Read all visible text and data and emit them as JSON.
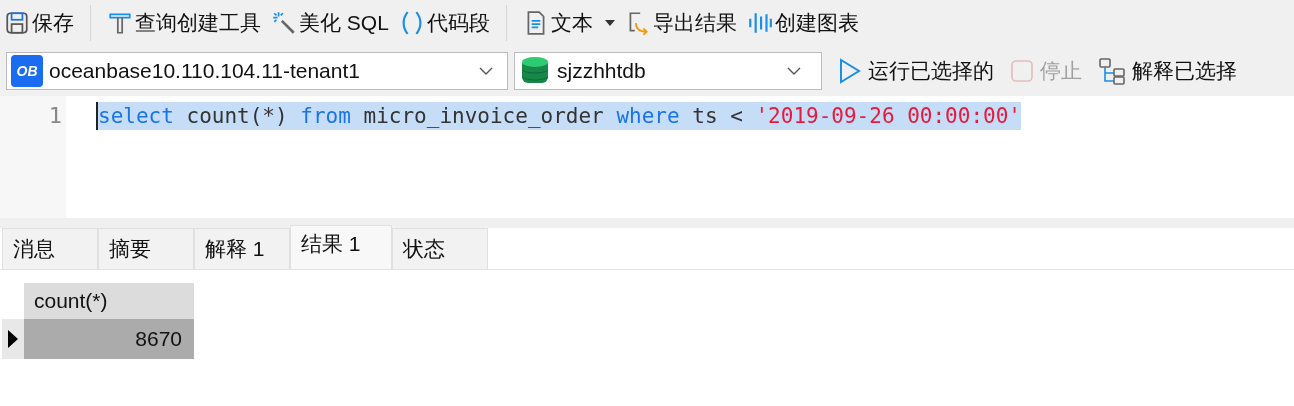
{
  "toolbar": [
    {
      "kind": "save",
      "label": "保存"
    },
    {
      "kind": "builder",
      "label": "查询创建工具"
    },
    {
      "kind": "beautify",
      "label": "美化 SQL"
    },
    {
      "kind": "snippet",
      "label": "代码段"
    },
    {
      "kind": "text",
      "label": "文本",
      "dropdown": true
    },
    {
      "kind": "export",
      "label": "导出结果"
    },
    {
      "kind": "chart",
      "label": "创建图表"
    }
  ],
  "connection": {
    "value": "oceanbase10.110.104.11-tenant1",
    "badge": "OB"
  },
  "database": {
    "value": "sjzzhhtdb"
  },
  "actions": [
    {
      "kind": "run",
      "label": "运行已选择的",
      "disabled": false
    },
    {
      "kind": "stop",
      "label": "停止",
      "disabled": true
    },
    {
      "kind": "explain",
      "label": "解释已选择",
      "disabled": false
    }
  ],
  "editor": {
    "lines": [
      {
        "number": "1",
        "selected": true,
        "tokens": [
          {
            "kind": "keyword",
            "text": "select"
          },
          {
            "kind": "plain",
            "text": " count(*) "
          },
          {
            "kind": "keyword",
            "text": "from"
          },
          {
            "kind": "plain",
            "text": " micro_invoice_order "
          },
          {
            "kind": "keyword",
            "text": "where"
          },
          {
            "kind": "plain",
            "text": " ts < "
          },
          {
            "kind": "string",
            "text": "'2019-09-26 00:00:00'"
          }
        ]
      }
    ]
  },
  "tabs": [
    {
      "label": "消息",
      "selected": false
    },
    {
      "label": "摘要",
      "selected": false
    },
    {
      "label": "解释 1",
      "selected": false
    },
    {
      "label": "结果 1",
      "selected": true
    },
    {
      "label": "状态",
      "selected": false
    }
  ],
  "result": {
    "columns": [
      "count(*)"
    ],
    "rows": [
      {
        "current": true,
        "cells": [
          "8670"
        ]
      }
    ]
  }
}
